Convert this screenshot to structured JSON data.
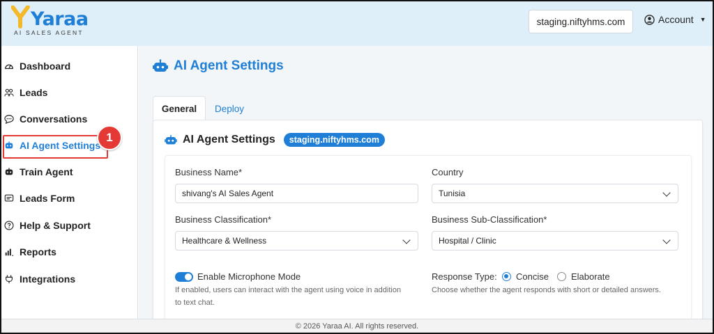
{
  "brand": {
    "name": "Yaraa",
    "tagline": "AI SALES AGENT",
    "colors": {
      "primary": "#1f7fd6",
      "logo_y": "#f4b82b",
      "annotation": "#e53935"
    }
  },
  "header": {
    "domain": "staging.niftyhms.com",
    "account_label": "Account",
    "account_icon": "user-circle-icon"
  },
  "sidebar": {
    "items": [
      {
        "label": "Dashboard",
        "icon": "gauge-icon"
      },
      {
        "label": "Leads",
        "icon": "users-icon"
      },
      {
        "label": "Conversations",
        "icon": "chat-icon"
      },
      {
        "label": "AI Agent Settings",
        "icon": "robot-icon",
        "active": true
      },
      {
        "label": "Train Agent",
        "icon": "robot-icon"
      },
      {
        "label": "Leads Form",
        "icon": "form-icon"
      },
      {
        "label": "Help & Support",
        "icon": "help-icon"
      },
      {
        "label": "Reports",
        "icon": "bar-chart-icon"
      },
      {
        "label": "Integrations",
        "icon": "plug-icon"
      }
    ],
    "annotation_number": "1"
  },
  "main": {
    "page_title": "AI Agent Settings",
    "tabs": [
      {
        "label": "General",
        "active": true
      },
      {
        "label": "Deploy",
        "active": false
      }
    ],
    "card": {
      "title": "AI Agent Settings",
      "domain_pill": "staging.niftyhms.com",
      "form": {
        "business_name": {
          "label": "Business Name*",
          "value": "shivang's AI Sales Agent"
        },
        "country": {
          "label": "Country",
          "value": "Tunisia"
        },
        "classification": {
          "label": "Business Classification*",
          "value": "Healthcare & Wellness"
        },
        "sub_classification": {
          "label": "Business Sub-Classification*",
          "value": "Hospital / Clinic"
        },
        "microphone": {
          "label": "Enable Microphone Mode",
          "enabled": true,
          "help_line1": "If enabled, users can interact with the agent using voice in addition",
          "help_line2": "to text chat."
        },
        "response_type": {
          "label": "Response Type:",
          "options": [
            "Concise",
            "Elaborate"
          ],
          "selected": "Concise",
          "help": "Choose whether the agent responds with short or detailed answers."
        }
      }
    }
  },
  "footer": {
    "text": "© 2026 Yaraa AI. All rights reserved."
  }
}
